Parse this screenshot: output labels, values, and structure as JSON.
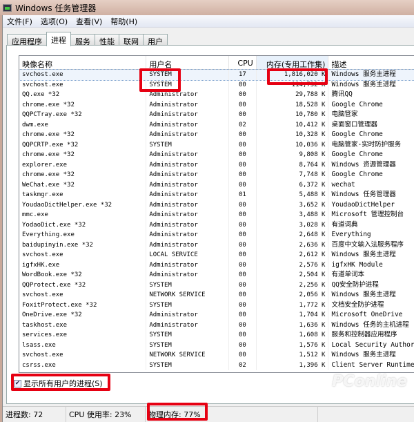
{
  "window": {
    "title": "Windows 任务管理器"
  },
  "menu": [
    "文件(F)",
    "选项(O)",
    "查看(V)",
    "帮助(H)"
  ],
  "tabs": [
    "应用程序",
    "进程",
    "服务",
    "性能",
    "联网",
    "用户"
  ],
  "columns": [
    "映像名称",
    "用户名",
    "CPU",
    "内存(专用工作集)",
    "描述"
  ],
  "rows": [
    [
      "svchost.exe",
      "SYSTEM",
      "17",
      "1,816,020 K",
      "Windows 服务主进程"
    ],
    [
      "svchost.exe",
      "SYSTEM",
      "00",
      "114,732 K",
      "Windows 服务主进程"
    ],
    [
      "QQ.exe *32",
      "Administrator",
      "00",
      "29,788 K",
      "腾讯QQ"
    ],
    [
      "chrome.exe *32",
      "Administrator",
      "00",
      "18,528 K",
      "Google Chrome"
    ],
    [
      "QQPCTray.exe *32",
      "Administrator",
      "00",
      "10,780 K",
      "电脑管家"
    ],
    [
      "dwm.exe",
      "Administrator",
      "02",
      "10,412 K",
      "桌面窗口管理器"
    ],
    [
      "chrome.exe *32",
      "Administrator",
      "00",
      "10,328 K",
      "Google Chrome"
    ],
    [
      "QQPCRTP.exe *32",
      "SYSTEM",
      "00",
      "10,036 K",
      "电脑管家-实时防护服务"
    ],
    [
      "chrome.exe *32",
      "Administrator",
      "00",
      "9,808 K",
      "Google Chrome"
    ],
    [
      "explorer.exe",
      "Administrator",
      "00",
      "8,764 K",
      "Windows 资源管理器"
    ],
    [
      "chrome.exe *32",
      "Administrator",
      "00",
      "7,748 K",
      "Google Chrome"
    ],
    [
      "WeChat.exe *32",
      "Administrator",
      "00",
      "6,372 K",
      "wechat"
    ],
    [
      "taskmgr.exe",
      "Administrator",
      "01",
      "5,488 K",
      "Windows 任务管理器"
    ],
    [
      "YoudaoDictHelper.exe *32",
      "Administrator",
      "00",
      "3,652 K",
      "YoudaoDictHelper"
    ],
    [
      "mmc.exe",
      "Administrator",
      "00",
      "3,488 K",
      "Microsoft 管理控制台"
    ],
    [
      "YodaoDict.exe *32",
      "Administrator",
      "00",
      "3,028 K",
      "有道词典"
    ],
    [
      "Everything.exe",
      "Administrator",
      "00",
      "2,648 K",
      "Everything"
    ],
    [
      "baidupinyin.exe *32",
      "Administrator",
      "00",
      "2,636 K",
      "百度中文输入法服务程序"
    ],
    [
      "svchost.exe",
      "LOCAL SERVICE",
      "00",
      "2,612 K",
      "Windows 服务主进程"
    ],
    [
      "igfxHK.exe",
      "Administrator",
      "00",
      "2,576 K",
      "igfxHK Module"
    ],
    [
      "WordBook.exe *32",
      "Administrator",
      "00",
      "2,504 K",
      "有道单词本"
    ],
    [
      "QQProtect.exe *32",
      "SYSTEM",
      "00",
      "2,256 K",
      "QQ安全防护进程"
    ],
    [
      "svchost.exe",
      "NETWORK SERVICE",
      "00",
      "2,056 K",
      "Windows 服务主进程"
    ],
    [
      "FoxitProtect.exe *32",
      "SYSTEM",
      "00",
      "1,772 K",
      "文档安全防护进程"
    ],
    [
      "OneDrive.exe *32",
      "Administrator",
      "00",
      "1,704 K",
      "Microsoft OneDrive"
    ],
    [
      "taskhost.exe",
      "Administrator",
      "00",
      "1,636 K",
      "Windows 任务的主机进程"
    ],
    [
      "services.exe",
      "SYSTEM",
      "00",
      "1,608 K",
      "服务和控制器应用程序"
    ],
    [
      "lsass.exe",
      "SYSTEM",
      "00",
      "1,576 K",
      "Local Security Authority"
    ],
    [
      "svchost.exe",
      "NETWORK SERVICE",
      "00",
      "1,512 K",
      "Windows 服务主进程"
    ],
    [
      "csrss.exe",
      "SYSTEM",
      "02",
      "1,396 K",
      "Client Server Runtime Process"
    ]
  ],
  "show_all_users": {
    "label": "显示所有用户的进程(S)",
    "checked": true
  },
  "status": {
    "processes": "进程数: 72",
    "cpu": "CPU 使用率: 23%",
    "memory": "物理内存: 77%"
  },
  "watermark": "PConline 太平洋电脑网",
  "highlight_color": "#e60012"
}
